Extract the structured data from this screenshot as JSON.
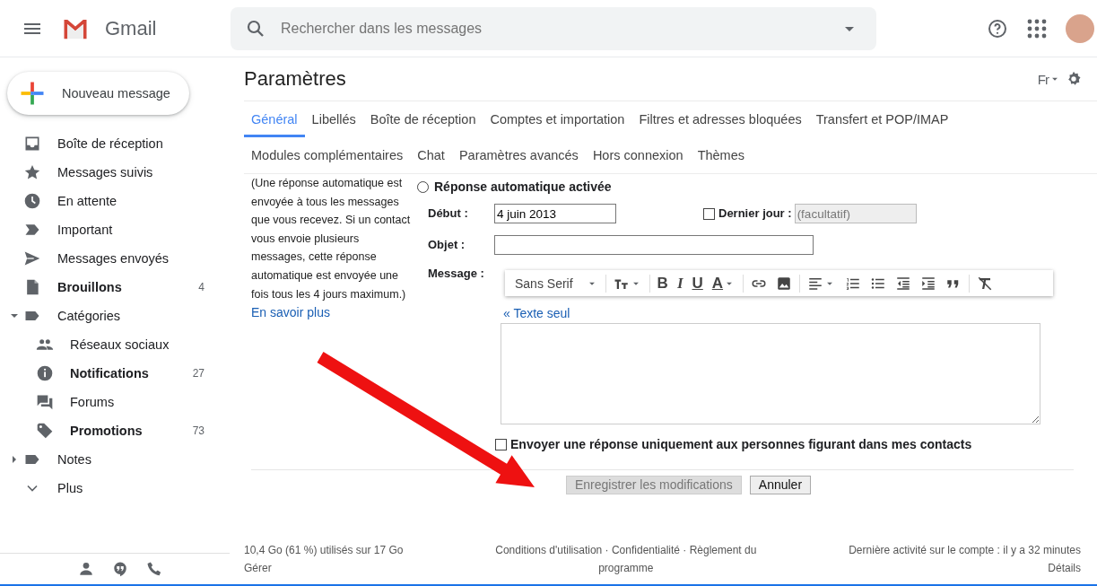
{
  "header": {
    "app_name": "Gmail",
    "search": {
      "placeholder": "Rechercher dans les messages"
    }
  },
  "sidebar": {
    "compose": "Nouveau message",
    "items": [
      {
        "label": "Boîte de réception",
        "unread": false
      },
      {
        "label": "Messages suivis",
        "unread": false
      },
      {
        "label": "En attente",
        "unread": false
      },
      {
        "label": "Important",
        "unread": false
      },
      {
        "label": "Messages envoyés",
        "unread": false
      },
      {
        "label": "Brouillons",
        "unread": true,
        "count": "4"
      },
      {
        "label": "Catégories",
        "unread": false,
        "expanded": true,
        "children": [
          {
            "label": "Réseaux sociaux",
            "unread": false
          },
          {
            "label": "Notifications",
            "unread": true,
            "count": "27"
          },
          {
            "label": "Forums",
            "unread": false
          },
          {
            "label": "Promotions",
            "unread": true,
            "count": "73"
          }
        ]
      },
      {
        "label": "Notes",
        "unread": false,
        "expanded": false
      },
      {
        "label": "Plus",
        "unread": false
      }
    ]
  },
  "settings": {
    "title": "Paramètres",
    "input_tools": "Fr",
    "tabs": [
      [
        {
          "label": "Général",
          "selected": true
        },
        {
          "label": "Libellés",
          "selected": false
        },
        {
          "label": "Boîte de réception",
          "selected": false
        },
        {
          "label": "Comptes et importation",
          "selected": false
        },
        {
          "label": "Filtres et adresses bloquées",
          "selected": false
        },
        {
          "label": "Transfert et POP/IMAP",
          "selected": false
        }
      ],
      [
        {
          "label": "Modules complémentaires",
          "selected": false
        },
        {
          "label": "Chat",
          "selected": false
        },
        {
          "label": "Paramètres avancés",
          "selected": false
        },
        {
          "label": "Hors connexion",
          "selected": false
        },
        {
          "label": "Thèmes",
          "selected": false
        }
      ]
    ],
    "description": "(Une réponse automatique est envoyée à tous les messages que vous recevez. Si un contact vous envoie plusieurs messages, cette réponse automatique est envoyée une fois tous les 4 jours maximum.)",
    "learn_more": "En savoir plus",
    "auto_reply": {
      "label": "Réponse automatique activée",
      "checked": false
    },
    "start": {
      "label": "Début :",
      "value": "4 juin 2013"
    },
    "last_day": {
      "label": "Dernier jour :",
      "checked": false,
      "placeholder": "(facultatif)",
      "disabled": true
    },
    "subject": {
      "label": "Objet :"
    },
    "message": {
      "label": "Message :"
    },
    "toolbar": [
      {
        "kind": "font",
        "text": "Sans Serif"
      },
      {
        "kind": "size"
      },
      {
        "kind": "bold",
        "text": "B"
      },
      {
        "kind": "italic",
        "text": "I"
      },
      {
        "kind": "underline",
        "text": "U"
      },
      {
        "kind": "color",
        "text": "A"
      },
      {
        "kind": "link"
      },
      {
        "kind": "image"
      },
      {
        "kind": "align"
      },
      {
        "kind": "numbered"
      },
      {
        "kind": "bulleted"
      },
      {
        "kind": "outdent"
      },
      {
        "kind": "indent"
      },
      {
        "kind": "quote"
      },
      {
        "kind": "clear"
      }
    ],
    "plain_text_link": "« Texte seul",
    "contacts_only": {
      "label": "Envoyer une réponse uniquement aux personnes figurant dans mes contacts",
      "checked": false
    },
    "buttons": [
      {
        "label": "Enregistrer les modifications",
        "disabled": true
      },
      {
        "label": "Annuler",
        "disabled": false
      }
    ]
  },
  "footer": {
    "storage": "10,4 Go (61 %) utilisés sur 17 Go",
    "manage": "Gérer",
    "terms": "Conditions d'utilisation · Confidentialité · Règlement du programme",
    "activity": "Dernière activité sur le compte : il y a 32 minutes",
    "details": "Détails"
  }
}
